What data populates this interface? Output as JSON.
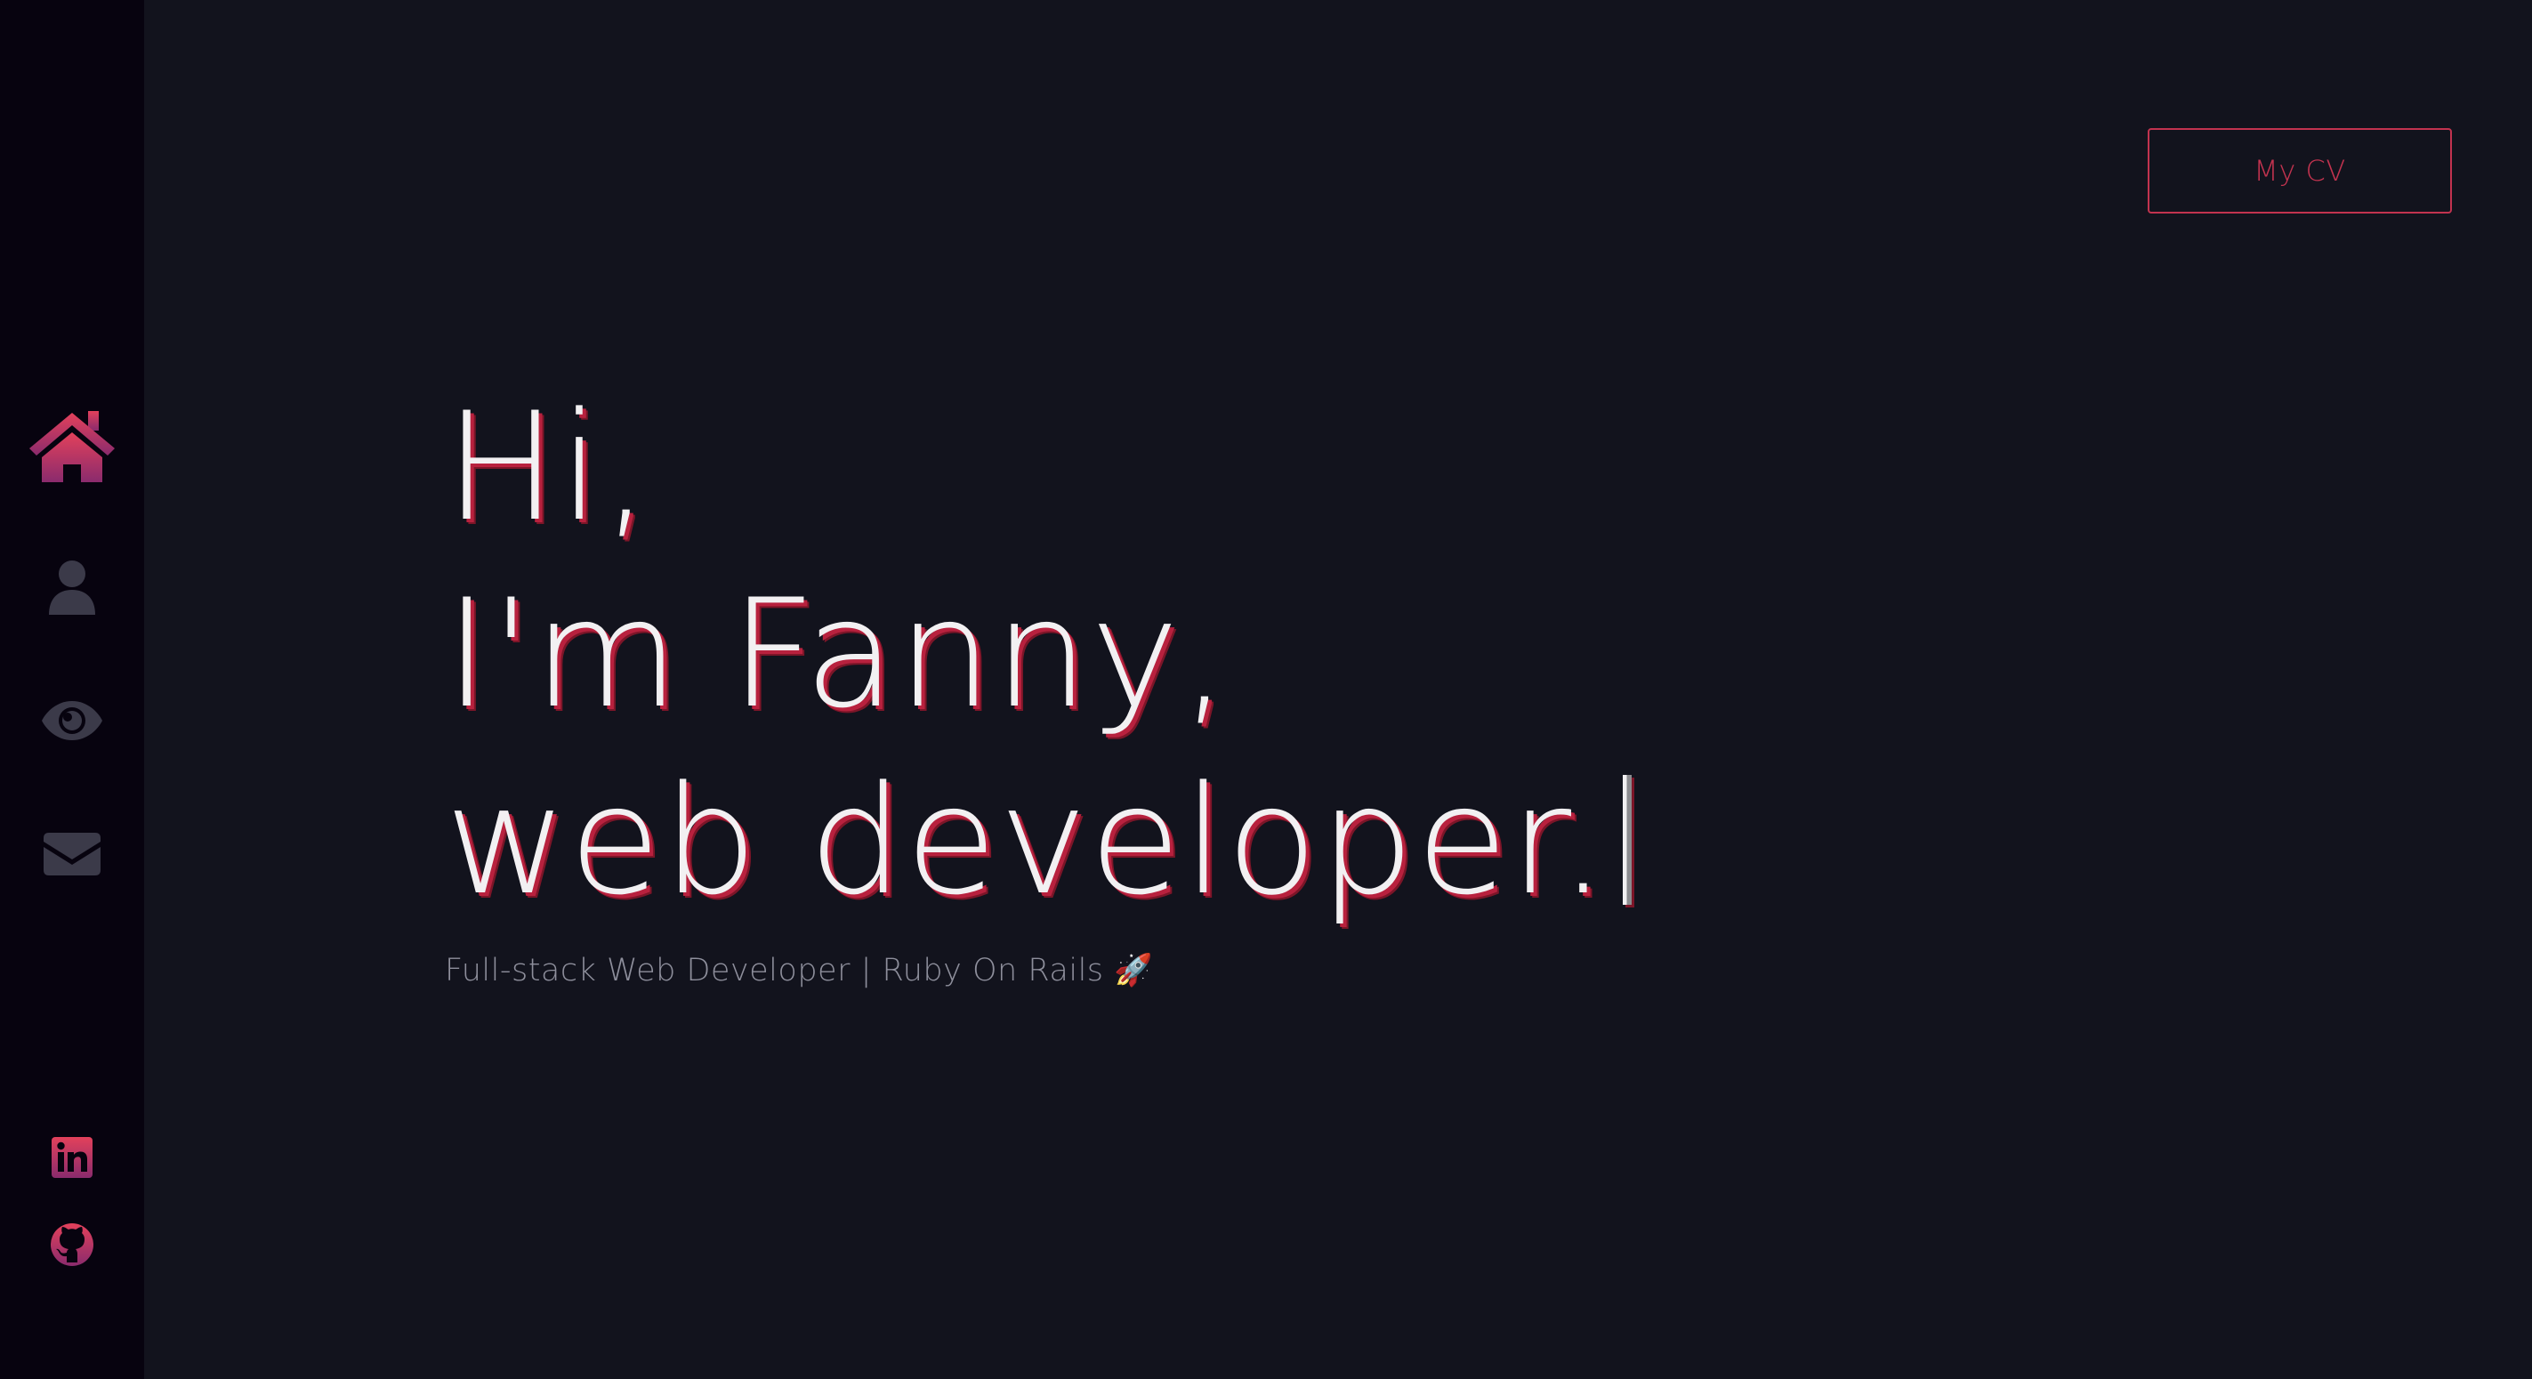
{
  "header": {
    "cv_button_label": "My CV"
  },
  "hero": {
    "line1": "Hi,",
    "line2": "I'm Fanny,",
    "line3": "web developer."
  },
  "tagline": "Full-stack Web Developer | Ruby On Rails 🚀",
  "sidebar": {
    "nav_items": [
      {
        "icon": "home-icon",
        "active": true
      },
      {
        "icon": "user-icon",
        "active": false
      },
      {
        "icon": "eye-icon",
        "active": false
      },
      {
        "icon": "envelope-icon",
        "active": false
      }
    ],
    "social_links": [
      {
        "icon": "linkedin-icon"
      },
      {
        "icon": "github-icon"
      }
    ]
  },
  "colors": {
    "background": "#12131d",
    "sidebar_background": "#07030f",
    "accent": "#c2334f",
    "accent_gradient_top": "#e0405a",
    "accent_gradient_bottom": "#8c2a6a",
    "inactive_icon": "#3b3a49",
    "heading_text": "#f2f0f2",
    "tagline_text": "#8e8f9c"
  }
}
